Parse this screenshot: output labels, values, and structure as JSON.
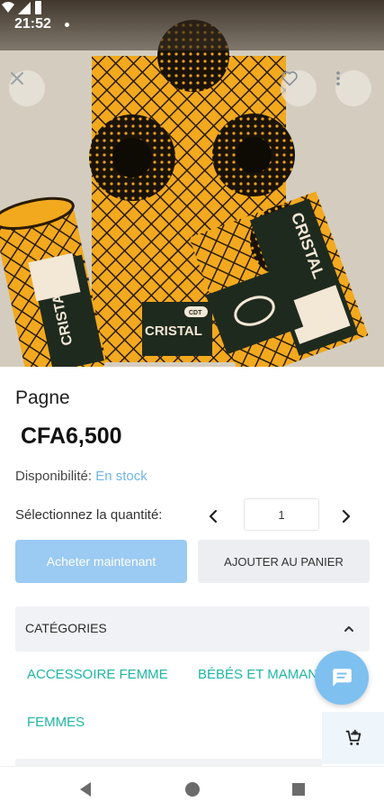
{
  "status_bar": {
    "time": "21:52"
  },
  "product": {
    "title": "Pagne",
    "price": "CFA6,500",
    "availability_label": "Disponibilité:",
    "availability_value": "En stock"
  },
  "quantity": {
    "label": "Sélectionnez la quantité:",
    "value": "1"
  },
  "actions": {
    "buy_now": "Acheter maintenant",
    "add_to_cart": "AJOUTER AU PANIER"
  },
  "categories": {
    "header": "CATÉGORIES",
    "items": [
      "ACCESSOIRE FEMME",
      "BÉBÉS ET MAMANS",
      "FEMMES"
    ]
  },
  "image_labels": {
    "brand": "CRISTAL",
    "monogram": "CDT"
  },
  "icons": {
    "close": "close-icon",
    "favorite": "heart-outline-icon",
    "more": "more-vert-icon",
    "quantity_prev": "chevron-left-icon",
    "quantity_next": "chevron-right-icon",
    "category_toggle": "chevron-up-icon",
    "chat": "chat-icon",
    "cart": "add-shopping-cart-icon",
    "nav_back": "triangle-back-icon",
    "nav_home": "circle-home-icon",
    "nav_recents": "square-recents-icon"
  },
  "colors": {
    "accent_blue": "#9bcaf2",
    "stock_blue": "#6eb6e8",
    "category_teal": "#1fb5a5",
    "fabric_yellow": "#f2a91e"
  }
}
